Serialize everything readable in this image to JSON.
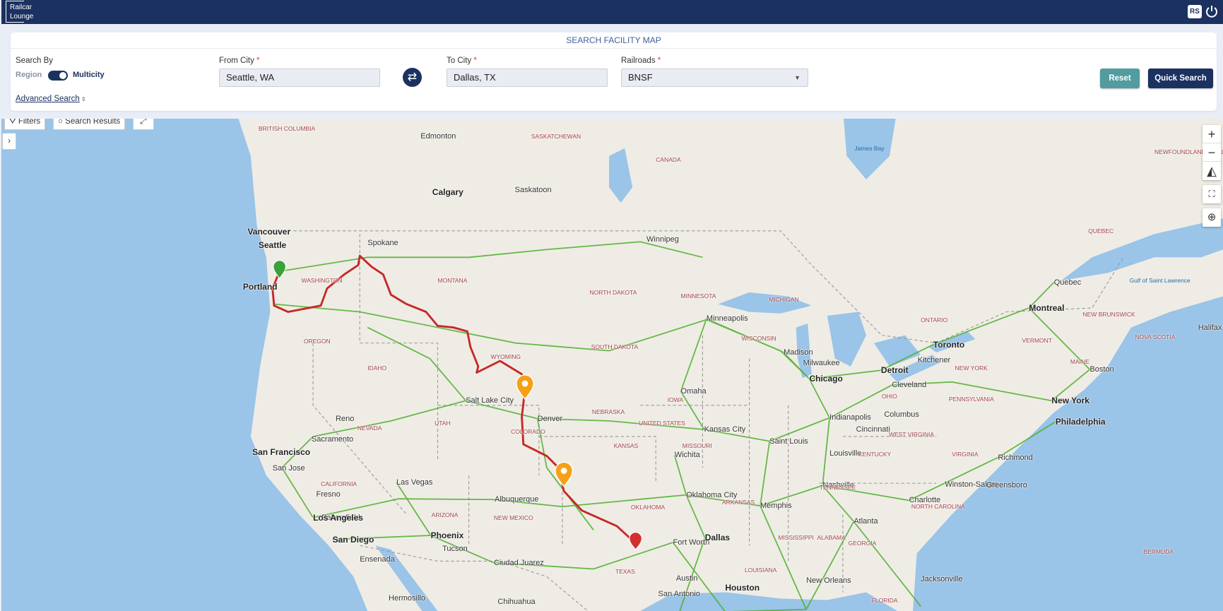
{
  "header": {
    "logo_line1": "Railcar",
    "logo_line2": "Lounge",
    "user_initials": "RS",
    "power_icon": "power-icon"
  },
  "search": {
    "title": "SEARCH FACILITY MAP",
    "search_by_label": "Search By",
    "toggle_left": "Region",
    "toggle_right": "Multicity",
    "toggle_state": "Multicity",
    "advanced_search": "Advanced Search",
    "from_label": "From City",
    "from_value": "Seattle, WA",
    "to_label": "To City",
    "to_value": "Dallas, TX",
    "railroads_label": "Railroads",
    "railroads_value": "BNSF",
    "required_mark": "*",
    "reset": "Reset",
    "quick_search": "Quick Search",
    "colors": {
      "primary": "#1b3160",
      "reset": "#529c9f"
    }
  },
  "map": {
    "filters": "Filters",
    "search_results": "Search Results",
    "controls": [
      "zoom-in",
      "zoom-out",
      "compass",
      "fullscreen",
      "locate"
    ],
    "route_color": "#c62828",
    "rail_color": "#4caf2a",
    "cities": [
      {
        "name": "Vancouver",
        "big": true
      },
      {
        "name": "Seattle",
        "big": true
      },
      {
        "name": "Portland",
        "big": true
      },
      {
        "name": "Spokane"
      },
      {
        "name": "Calgary",
        "big": true
      },
      {
        "name": "Edmonton"
      },
      {
        "name": "Saskatoon"
      },
      {
        "name": "Winnipeg"
      },
      {
        "name": "Salt Lake City"
      },
      {
        "name": "Denver"
      },
      {
        "name": "Reno"
      },
      {
        "name": "Sacramento"
      },
      {
        "name": "San Francisco",
        "big": true
      },
      {
        "name": "San Jose"
      },
      {
        "name": "Fresno"
      },
      {
        "name": "Bakersfield"
      },
      {
        "name": "Los Angeles",
        "big": true
      },
      {
        "name": "San Diego",
        "big": true
      },
      {
        "name": "Las Vegas"
      },
      {
        "name": "Phoenix",
        "big": true
      },
      {
        "name": "Tucson"
      },
      {
        "name": "Albuquerque"
      },
      {
        "name": "Ciudad Juarez"
      },
      {
        "name": "Hermosillo"
      },
      {
        "name": "Chihuahua"
      },
      {
        "name": "Oklahoma City"
      },
      {
        "name": "Wichita"
      },
      {
        "name": "Kansas City"
      },
      {
        "name": "Omaha"
      },
      {
        "name": "Minneapolis"
      },
      {
        "name": "Madison"
      },
      {
        "name": "Milwaukee"
      },
      {
        "name": "Chicago",
        "big": true
      },
      {
        "name": "Detroit",
        "big": true
      },
      {
        "name": "Kitchener"
      },
      {
        "name": "Toronto",
        "big": true
      },
      {
        "name": "Montreal",
        "big": true
      },
      {
        "name": "Quebec"
      },
      {
        "name": "Halifax"
      },
      {
        "name": "Boston"
      },
      {
        "name": "New York",
        "big": true
      },
      {
        "name": "Philadelphia",
        "big": true
      },
      {
        "name": "Cleveland"
      },
      {
        "name": "Columbus"
      },
      {
        "name": "Indianapolis"
      },
      {
        "name": "Cincinnati"
      },
      {
        "name": "Saint Louis"
      },
      {
        "name": "Louisville"
      },
      {
        "name": "Nashville"
      },
      {
        "name": "Memphis"
      },
      {
        "name": "Atlanta"
      },
      {
        "name": "Charlotte"
      },
      {
        "name": "Winston-Salem"
      },
      {
        "name": "Greensboro"
      },
      {
        "name": "Richmond"
      },
      {
        "name": "Fort Worth"
      },
      {
        "name": "Dallas",
        "big": true
      },
      {
        "name": "Austin"
      },
      {
        "name": "San Antonio"
      },
      {
        "name": "Houston",
        "big": true
      },
      {
        "name": "New Orleans"
      },
      {
        "name": "Jacksonville"
      },
      {
        "name": "Ensenada"
      }
    ],
    "regions": [
      "BRITISH COLUMBIA",
      "SASKATCHEWAN",
      "CANADA",
      "NEWFOUNDLAND AND LABRADOR",
      "QUEBEC",
      "ONTARIO",
      "WASHINGTON",
      "MONTANA",
      "NORTH DAKOTA",
      "MINNESOTA",
      "OREGON",
      "IDAHO",
      "SOUTH DAKOTA",
      "WYOMING",
      "WISCONSIN",
      "MICHIGAN",
      "NEVADA",
      "UTAH",
      "COLORADO",
      "NEBRASKA",
      "IOWA",
      "UNITED STATES",
      "KANSAS",
      "MISSOURI",
      "CALIFORNIA",
      "ARIZONA",
      "NEW MEXICO",
      "OKLAHOMA",
      "ARKANSAS",
      "TEXAS",
      "LOUISIANA",
      "MISSISSIPPI",
      "ALABAMA",
      "GEORGIA",
      "TENNESSEE",
      "KENTUCKY",
      "NORTH CAROLINA",
      "VIRGINIA",
      "WEST VIRGINIA",
      "PENNSYLVANIA",
      "OHIO",
      "NEW YORK",
      "VERMONT",
      "MAINE",
      "NEW BRUNSWICK",
      "NOVA SCOTIA",
      "FLORIDA",
      "BERMUDA"
    ],
    "water": [
      "James Bay",
      "Gulf of Saint Lawrence"
    ]
  }
}
